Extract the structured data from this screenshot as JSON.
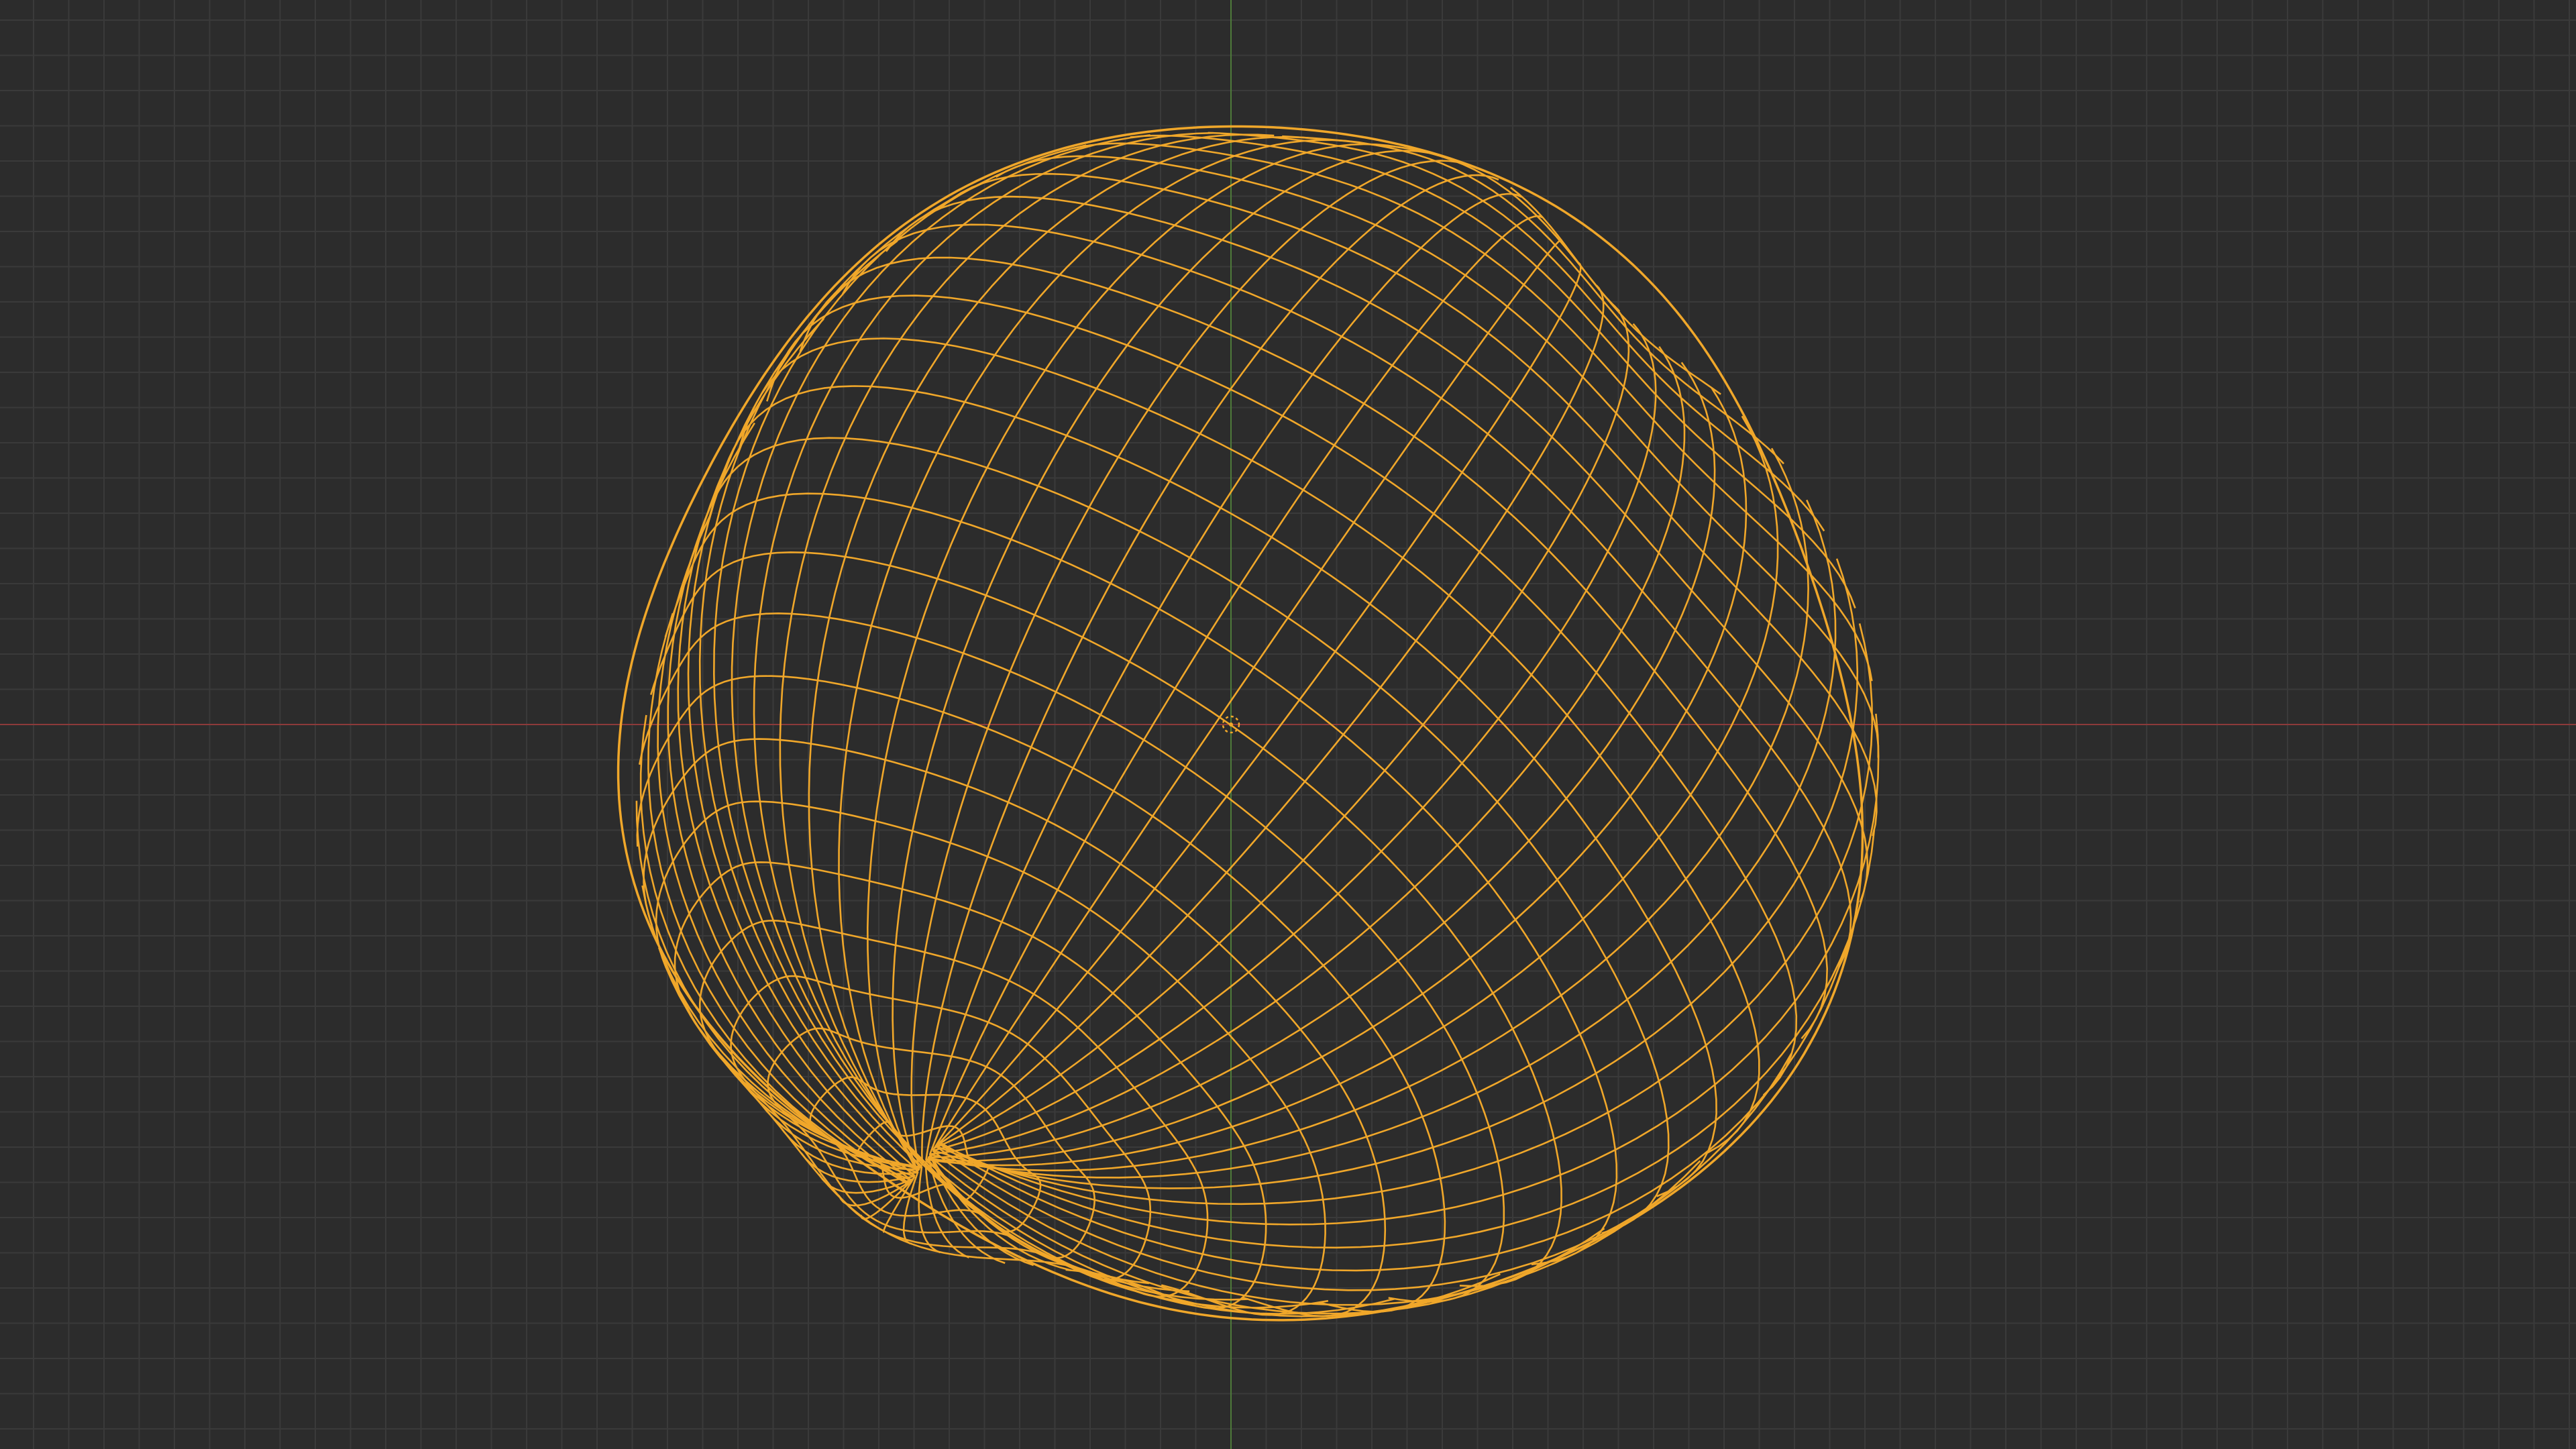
{
  "viewport": {
    "background": "#2c2c2c",
    "grid_color": "#3a3a3a",
    "x_axis_color": "#8c3a3a",
    "y_axis_color": "#4e7a3a",
    "selection_color": "#f0a72a",
    "object": "wireframe-uv-sphere",
    "origin_marker_icon": "object-origin-icon"
  }
}
